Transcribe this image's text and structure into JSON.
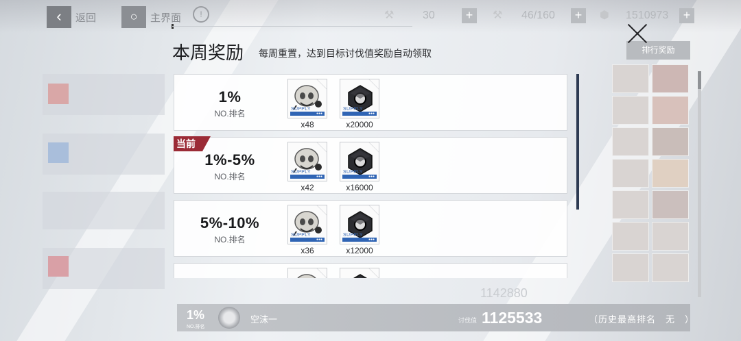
{
  "topbar": {
    "back_label": "返回",
    "home_label": "主界面",
    "resources": [
      {
        "value": "30"
      },
      {
        "value": "46/160"
      },
      {
        "value": "1510973"
      }
    ]
  },
  "background": {
    "rank_reward_button": "排行奖励",
    "score_ghost": "1142880"
  },
  "modal": {
    "title": "本周奖励",
    "subtitle": "每周重置，达到目标讨伐值奖励自动领取",
    "rows": [
      {
        "rank": "1%",
        "rank_label": "NO.排名",
        "badge": "",
        "rewards": [
          {
            "type": "supply-mask",
            "count": "x48"
          },
          {
            "type": "hex-nut",
            "count": "x20000"
          }
        ]
      },
      {
        "rank": "1%-5%",
        "rank_label": "NO.排名",
        "badge": "当前",
        "rewards": [
          {
            "type": "supply-mask",
            "count": "x42"
          },
          {
            "type": "hex-nut",
            "count": "x16000"
          }
        ]
      },
      {
        "rank": "5%-10%",
        "rank_label": "NO.排名",
        "badge": "",
        "rewards": [
          {
            "type": "supply-mask",
            "count": "x36"
          },
          {
            "type": "hex-nut",
            "count": "x12000"
          }
        ]
      },
      {
        "rank": "",
        "rank_label": "",
        "badge": "",
        "rewards": [
          {
            "type": "supply-mask",
            "count": ""
          },
          {
            "type": "hex-nut",
            "count": ""
          }
        ]
      }
    ],
    "supply_text": "SUPPLY"
  },
  "bottom_bar": {
    "rank": "1%",
    "rank_sub": "NO.排名",
    "player_name": "空沫一",
    "score_label": "讨伐值",
    "score": "1125533",
    "history": "（历史最高排名　无　）"
  },
  "colors": {
    "badge": "#9b2b36",
    "supply_blue": "#2f64b4",
    "scroll": "#2d3a52"
  }
}
